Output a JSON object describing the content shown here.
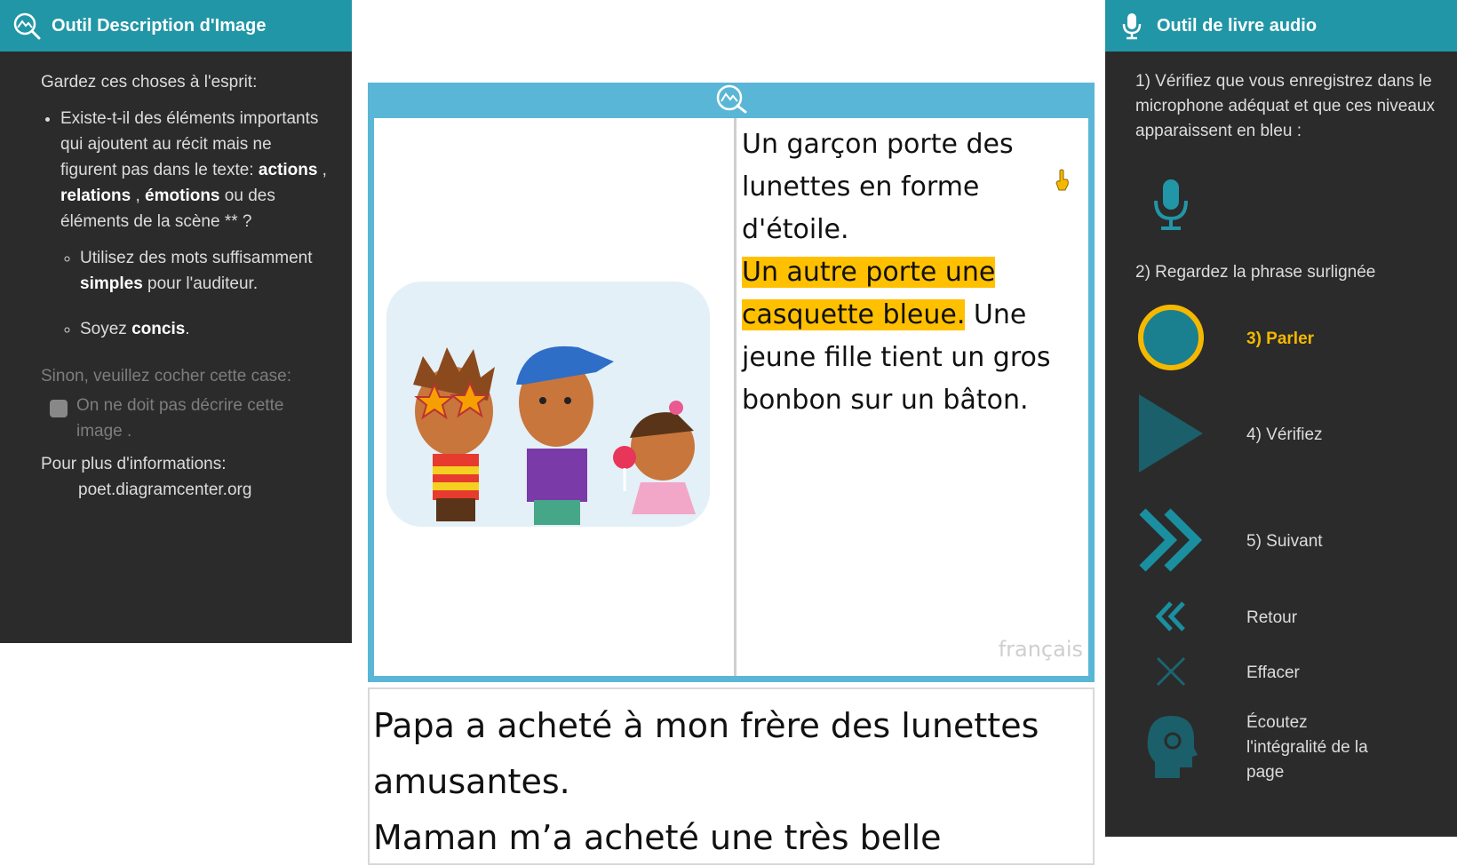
{
  "left_panel": {
    "title": "Outil Description d'Image",
    "intro": "Gardez ces choses à l'esprit:",
    "bullet1": {
      "pre": "Existe-t-il des éléments importants qui ajoutent au récit mais ne figurent pas dans le texte: ",
      "b_actions": "actions",
      "sep1": " , ",
      "b_relations": "relations",
      "sep2": " , ",
      "b_emotions": "émotions",
      "post": " ou des éléments de la scène ** ?"
    },
    "sub1": {
      "pre": "Utilisez des mots suffisamment ",
      "bold": "simples",
      "post": " pour l'auditeur."
    },
    "sub2": {
      "pre": "Soyez ",
      "bold": "concis",
      "post": "."
    },
    "optout_question": "Sinon, veuillez cocher cette case:",
    "checkbox_label": "On ne doit pas décrire cette image .",
    "info_label": "Pour plus d'informations:",
    "info_url": "poet.diagramcenter.org"
  },
  "right_panel": {
    "title": "Outil de livre audio",
    "step1": "1) Vérifiez que vous enregistrez dans le microphone adéquat et que ces niveaux apparaissent en bleu :",
    "step2": "2) Regardez la phrase surlignée",
    "step3": "3) Parler",
    "step4": "4) Vérifiez",
    "step5": "5) Suivant",
    "back": "Retour",
    "clear": "Effacer",
    "listen": "Écoutez l'intégralité de la page"
  },
  "book": {
    "sentence1": "Un garçon porte des lunettes en forme d'étoile.",
    "sentence2_highlighted": "Un autre porte une casquette bleue.",
    "sentence3": " Une jeune fille tient un gros bonbon sur un bâton.",
    "language": "français"
  },
  "story": {
    "line1": "Papa a acheté à mon frère des lunettes amusantes.",
    "line2": "Maman m’a acheté une très belle"
  },
  "colors": {
    "accent_teal": "#2196a6",
    "record_ring": "#f5b800",
    "highlight": "#ffc000",
    "book_frame": "#5ab6d6",
    "panel_bg": "#2b2b2b"
  },
  "icons": [
    "image-description-icon",
    "microphone-icon",
    "record-icon",
    "play-icon",
    "next-icon",
    "back-icon",
    "clear-icon",
    "listen-head-icon",
    "cursor-hand-icon"
  ]
}
